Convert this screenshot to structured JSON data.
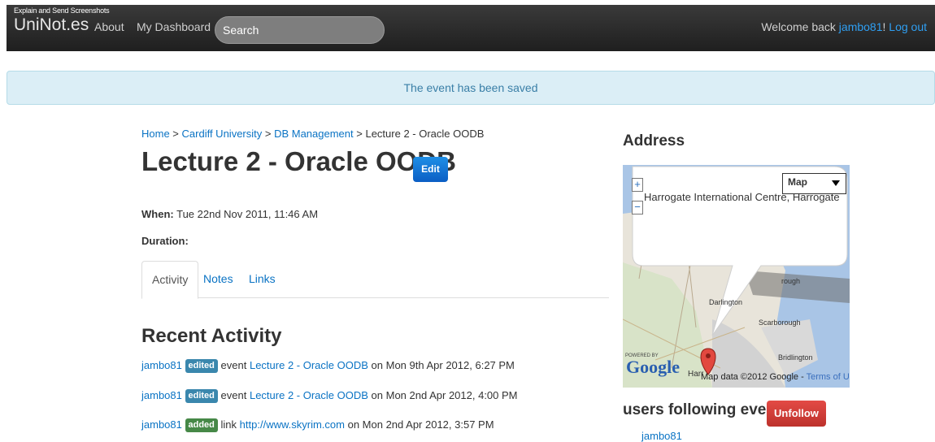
{
  "navbar": {
    "tiny_text": "Explain and Send Screenshots",
    "brand": "UniNot.es",
    "about": "About",
    "dashboard": "My Dashboard",
    "search_placeholder": "Search",
    "welcome_prefix": "Welcome back ",
    "username": "jambo81",
    "exclaim": "!",
    "logout": "Log out"
  },
  "alert": {
    "message": "The event has been saved"
  },
  "breadcrumb": {
    "home": "Home",
    "sep": " > ",
    "university": "Cardiff University",
    "module": "DB Management",
    "current": "Lecture 2 - Oracle OODB"
  },
  "event": {
    "title": "Lecture 2 - Oracle OODB",
    "edit_label": "Edit",
    "when_label": "When:",
    "when_value": "Tue 22nd Nov 2011, 11:46 AM",
    "duration_label": "Duration:"
  },
  "tabs": [
    "Activity",
    "Notes",
    "Links"
  ],
  "activity": {
    "heading": "Recent Activity",
    "items": [
      {
        "user": "jambo81",
        "badge": "edited",
        "type": "event",
        "target": "Lecture 2 - Oracle OODB",
        "date": "on Mon 9th Apr 2012, 6:27 PM"
      },
      {
        "user": "jambo81",
        "badge": "edited",
        "type": "event",
        "target": "Lecture 2 - Oracle OODB",
        "date": "on Mon 2nd Apr 2012, 4:00 PM"
      },
      {
        "user": "jambo81",
        "badge": "added",
        "type": "link",
        "target": "http://www.skyrim.com",
        "date": "on Mon 2nd Apr 2012, 3:57 PM"
      }
    ]
  },
  "address": {
    "heading": "Address",
    "map": {
      "type_label": "Map",
      "zoom_in": "+",
      "zoom_out": "−",
      "balloon": "Harrogate International Centre, Harrogate",
      "places": [
        "Darlington",
        "Scarborough",
        "Bridlington",
        "Harr",
        "rough"
      ],
      "powered_by": "POWERED BY",
      "google": "Google",
      "map_data": "Map data ©2012 Google - ",
      "terms": "Terms of Use"
    }
  },
  "following": {
    "heading": "users following event",
    "unfollow_label": "Unfollow",
    "users": [
      "jambo81"
    ]
  },
  "colors": {
    "link": "#0a73c4",
    "edit": "#0b5ec4",
    "unfollow": "#bd322c",
    "alert_bg": "#dbeef6"
  }
}
